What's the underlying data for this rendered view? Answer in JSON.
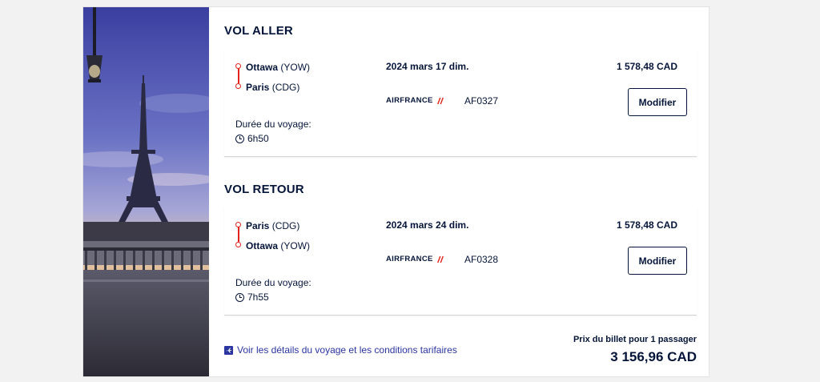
{
  "outbound": {
    "title": "VOL ALLER",
    "from": {
      "city": "Ottawa",
      "code": "(YOW)"
    },
    "to": {
      "city": "Paris",
      "code": "(CDG)"
    },
    "date": "2024 mars 17 dim.",
    "airline": "AIRFRANCE",
    "flight_number": "AF0327",
    "price": "1 578,48 CAD",
    "modify_label": "Modifier",
    "duration_label": "Durée du voyage:",
    "duration": "6h50"
  },
  "return": {
    "title": "VOL RETOUR",
    "from": {
      "city": "Paris",
      "code": "(CDG)"
    },
    "to": {
      "city": "Ottawa",
      "code": "(YOW)"
    },
    "date": "2024 mars 24 dim.",
    "airline": "AIRFRANCE",
    "flight_number": "AF0328",
    "price": "1 578,48 CAD",
    "modify_label": "Modifier",
    "duration_label": "Durée du voyage:",
    "duration": "7h55"
  },
  "footer": {
    "details_link": "Voir les détails du voyage et les conditions tarifaires",
    "total_label": "Prix du billet pour 1 passager",
    "total_price": "3 156,96 CAD"
  },
  "colors": {
    "navy": "#05153a",
    "red": "#e2231a",
    "link": "#2a35a0"
  },
  "icons": [
    "route-origin-icon",
    "route-destination-icon",
    "clock-icon",
    "airfrance-logo-icon",
    "plane-info-icon"
  ]
}
